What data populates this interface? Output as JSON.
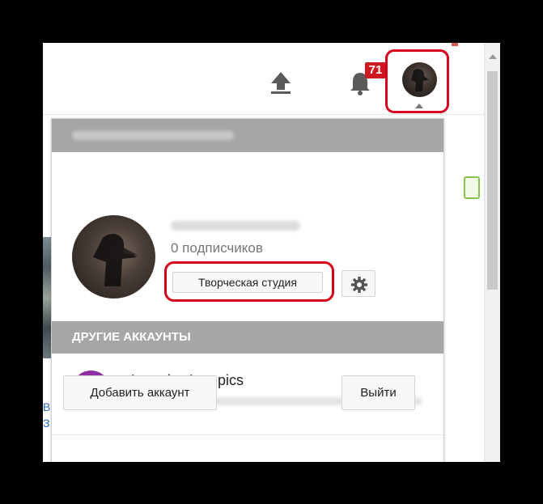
{
  "masthead": {
    "upload_icon": "upload-icon",
    "notifications_icon": "bell-icon",
    "notifications_count": "71",
    "account_avatar_icon": "avatar-icon"
  },
  "account_menu": {
    "subscribers": "0 подписчиков",
    "creator_studio_label": "Творческая студия",
    "settings_icon": "gear-icon",
    "other_accounts_title": "ДРУГИЕ АККАУНТЫ",
    "other_account": {
      "name": "Lumpics Lumpics"
    },
    "add_account_label": "Добавить аккаунт",
    "sign_out_label": "Выйти"
  },
  "colors": {
    "highlight": "#d6001c",
    "badge": "#cc181e",
    "section_bar": "#a6a6a6",
    "account_avatar": "#8e2da4"
  }
}
